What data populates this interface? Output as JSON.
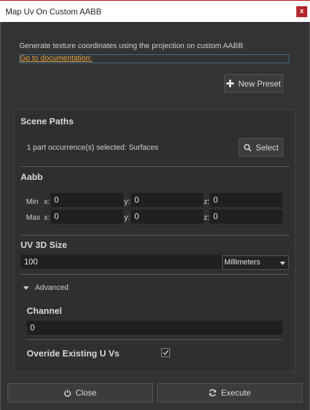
{
  "window": {
    "title": "Map Uv On Custom AABB",
    "close_label": "x"
  },
  "header": {
    "description": "Generate texture coordinates using the projection on custom AABB",
    "doc_link": "Go to documentation:",
    "new_preset_label": "New Preset"
  },
  "scene_paths": {
    "title": "Scene Paths",
    "selection_text": "1 part occurrence(s) selected: Surfaces",
    "select_label": "Select"
  },
  "aabb": {
    "title": "Aabb",
    "min_label": "Min",
    "max_label": "Max",
    "x_label": "x:",
    "y_label": "y:",
    "z_label": "z:",
    "min": {
      "x": "0",
      "y": "0",
      "z": "0"
    },
    "max": {
      "x": "0",
      "y": "0",
      "z": "0"
    }
  },
  "uv_size": {
    "title": "UV 3D Size",
    "value": "100",
    "unit": "Millimeters"
  },
  "advanced": {
    "label": "Advanced",
    "channel_title": "Channel",
    "channel_value": "0",
    "override_label": "Overide Existing U Vs",
    "override_checked": true
  },
  "footer": {
    "close_label": "Close",
    "execute_label": "Execute"
  }
}
